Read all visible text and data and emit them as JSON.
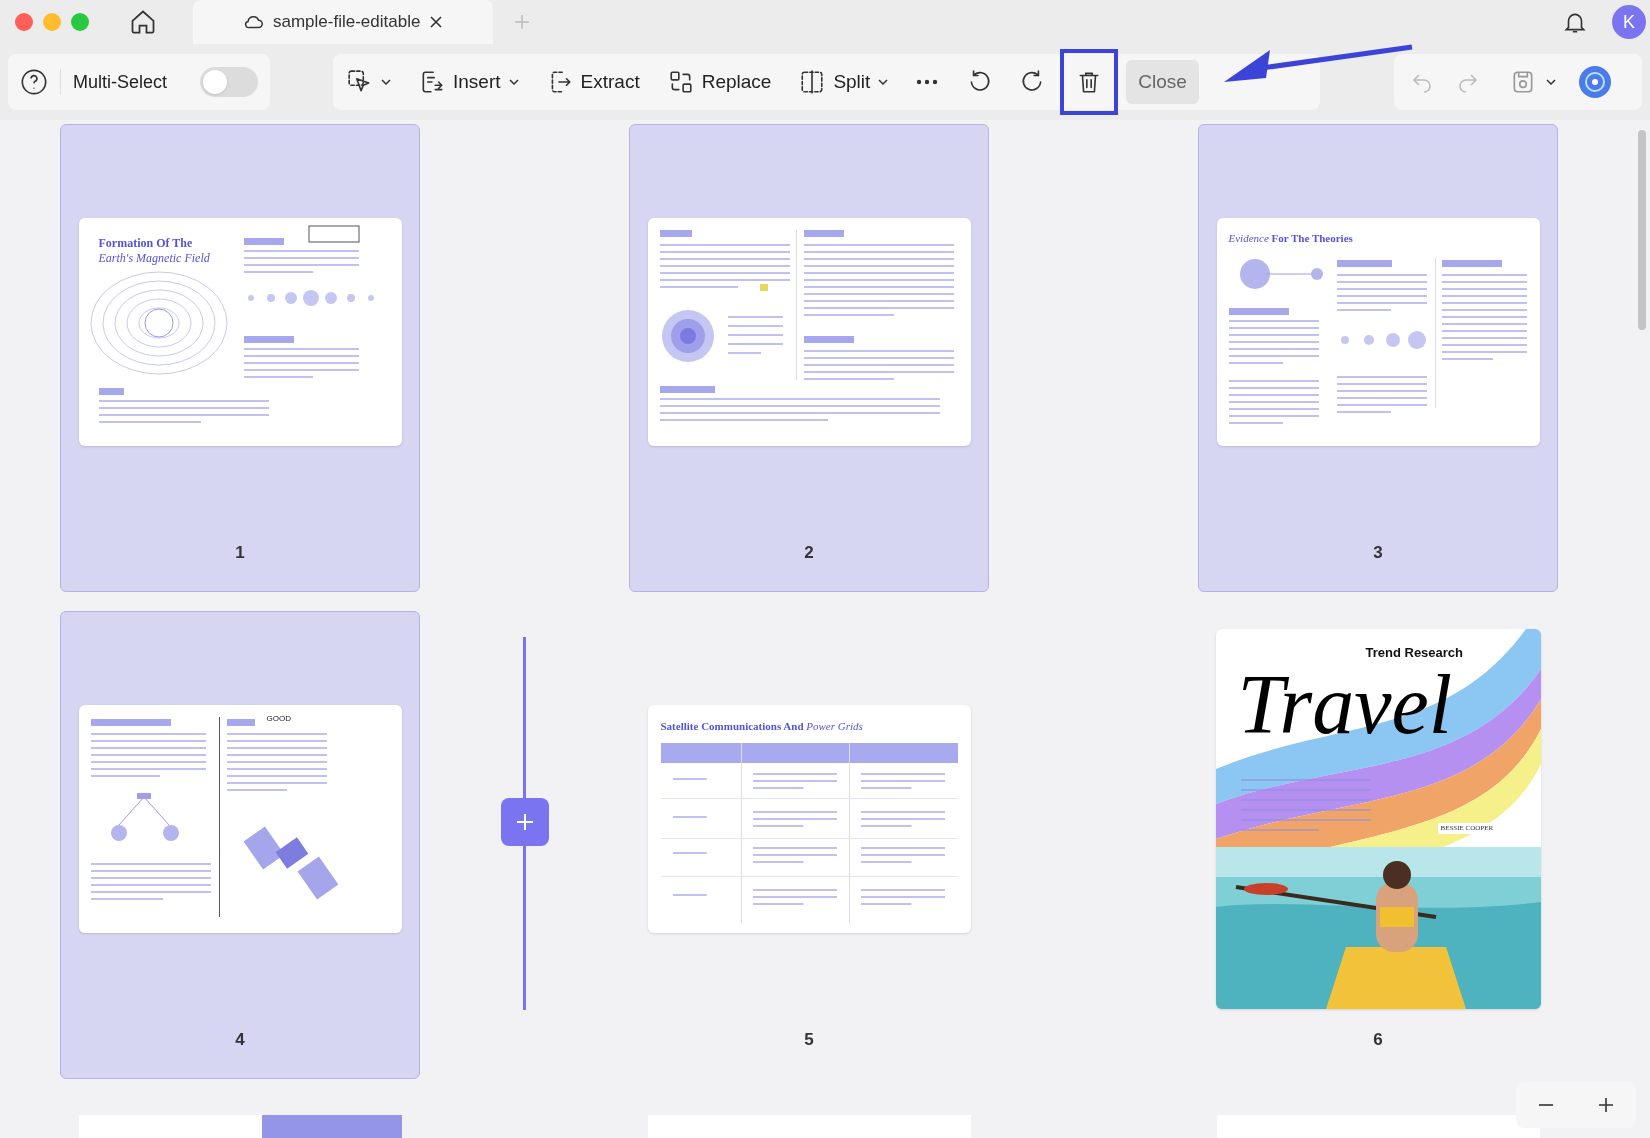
{
  "window": {
    "tab_title": "sample-file-editable",
    "user_initial": "K"
  },
  "toolbar": {
    "multi_select": {
      "label": "Multi-Select",
      "on": false
    },
    "tools": [
      {
        "kind": "select",
        "has_menu": true
      },
      {
        "kind": "insert",
        "label": "Insert",
        "has_menu": true
      },
      {
        "kind": "extract",
        "label": "Extract",
        "has_menu": false
      },
      {
        "kind": "replace",
        "label": "Replace",
        "has_menu": false
      },
      {
        "kind": "split",
        "label": "Split",
        "has_menu": true
      },
      {
        "kind": "more",
        "has_menu": false
      },
      {
        "kind": "rotate_left",
        "has_menu": false
      },
      {
        "kind": "rotate_right",
        "has_menu": false
      },
      {
        "kind": "delete",
        "has_menu": false
      }
    ],
    "close_label": "Close",
    "undo_disabled": true,
    "redo_disabled": true
  },
  "pages": [
    {
      "number": "1",
      "selected": true,
      "kind": "magnetic",
      "title": "Formation Of The",
      "subtitle": "Earth's Magnetic Field"
    },
    {
      "number": "2",
      "selected": true,
      "kind": "layers"
    },
    {
      "number": "3",
      "selected": true,
      "kind": "theories",
      "title_italic": "Evidence",
      "title": "For The Theories"
    },
    {
      "number": "4",
      "selected": true,
      "kind": "satellite",
      "note": "GOOD"
    },
    {
      "number": "5",
      "selected": false,
      "kind": "table",
      "title": "Satellite Communications And",
      "title_italic": "Power Grids"
    },
    {
      "number": "6",
      "selected": false,
      "kind": "cover",
      "script_title": "Travel",
      "subtitle": "Trend Research",
      "author": "BESSIE COOPER"
    }
  ]
}
